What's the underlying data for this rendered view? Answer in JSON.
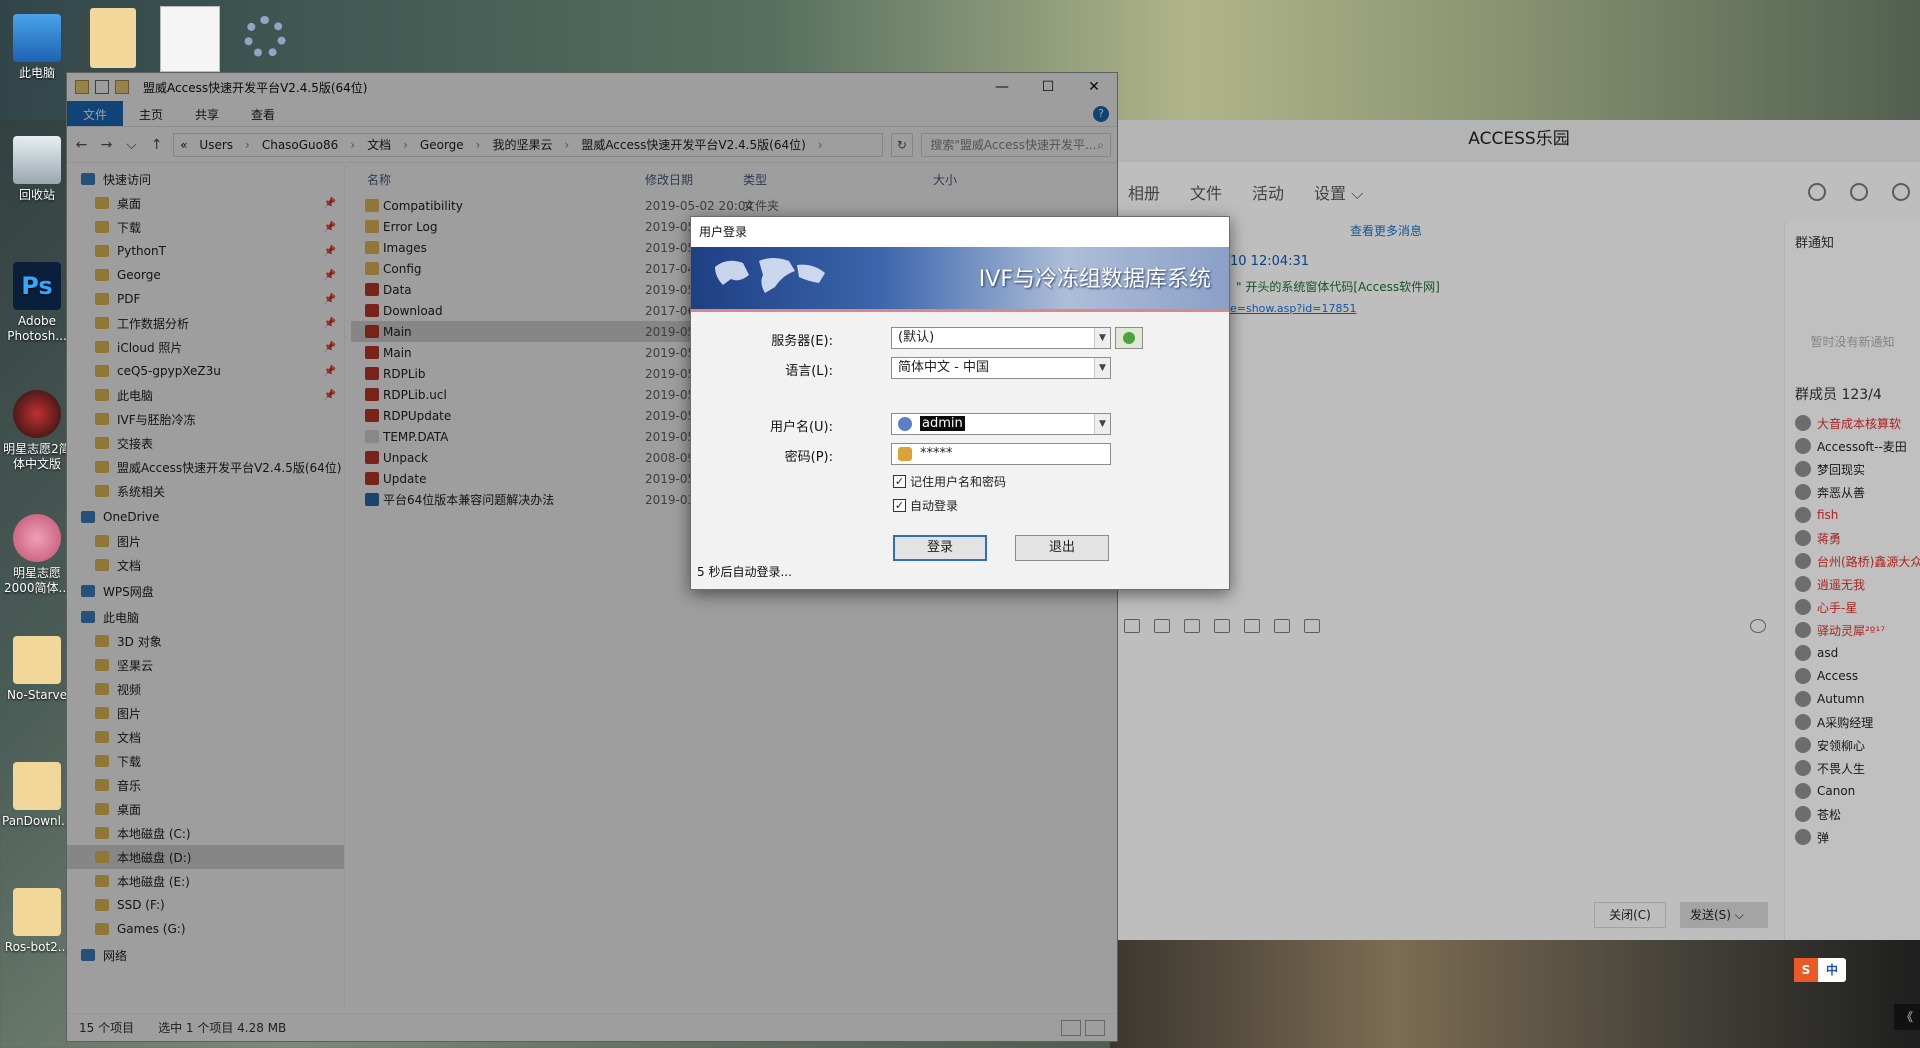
{
  "desktop": {
    "icons": [
      {
        "label": "此电脑"
      },
      {
        "label": "回收站"
      },
      {
        "label": "Adobe Photosh..."
      },
      {
        "label": "明星志愿2简体中文版"
      },
      {
        "label": "明星志愿2000简体..."
      },
      {
        "label": "No-Starve"
      },
      {
        "label": "PanDownl..."
      },
      {
        "label": "Ros-bot2..."
      }
    ]
  },
  "explorer": {
    "title": "盟威Access快速开发平台V2.4.5版(64位)",
    "ribbon_tabs": [
      "文件",
      "主页",
      "共享",
      "查看"
    ],
    "address": [
      "«",
      "Users",
      "ChasoGuo86",
      "文档",
      "George",
      "我的坚果云",
      "盟威Access快速开发平台V2.4.5版(64位)"
    ],
    "search_placeholder": "搜索\"盟威Access快速开发平...",
    "nav": [
      {
        "label": "快速访问",
        "group": true
      },
      {
        "label": "桌面",
        "pinned": true
      },
      {
        "label": "下载",
        "pinned": true
      },
      {
        "label": "PythonT",
        "pinned": true
      },
      {
        "label": "George",
        "pinned": true
      },
      {
        "label": "PDF",
        "pinned": true
      },
      {
        "label": "工作数据分析",
        "pinned": true
      },
      {
        "label": "iCloud 照片",
        "pinned": true
      },
      {
        "label": "ceQ5-gpypXeZ3u",
        "pinned": true
      },
      {
        "label": "此电脑",
        "pinned": true
      },
      {
        "label": "IVF与胚胎冷冻"
      },
      {
        "label": "交接表"
      },
      {
        "label": "盟威Access快速开发平台V2.4.5版(64位)"
      },
      {
        "label": "系统相关"
      },
      {
        "label": "OneDrive",
        "group": true
      },
      {
        "label": "图片"
      },
      {
        "label": "文档"
      },
      {
        "label": "WPS网盘",
        "group": true
      },
      {
        "label": "此电脑",
        "group": true
      },
      {
        "label": "3D 对象"
      },
      {
        "label": "坚果云"
      },
      {
        "label": "视频"
      },
      {
        "label": "图片"
      },
      {
        "label": "文档"
      },
      {
        "label": "下载"
      },
      {
        "label": "音乐"
      },
      {
        "label": "桌面"
      },
      {
        "label": "本地磁盘 (C:)"
      },
      {
        "label": "本地磁盘 (D:)",
        "selected": true
      },
      {
        "label": "本地磁盘 (E:)"
      },
      {
        "label": "SSD (F:)"
      },
      {
        "label": "Games (G:)"
      },
      {
        "label": "网络",
        "group": true
      }
    ],
    "columns": {
      "name": "名称",
      "date": "修改日期",
      "type": "类型",
      "size": "大小"
    },
    "files": [
      {
        "name": "Compatibility",
        "date": "2019-05-02 20:04",
        "type": "文件夹",
        "color": "#e8c15a"
      },
      {
        "name": "Error Log",
        "date": "2019-05-1",
        "type": "",
        "color": "#e8c15a"
      },
      {
        "name": "Images",
        "date": "2019-05-0",
        "type": "",
        "color": "#e8c15a"
      },
      {
        "name": "Config",
        "date": "2017-04-2",
        "type": "",
        "color": "#e8c15a"
      },
      {
        "name": "Data",
        "date": "2019-05-1",
        "type": "",
        "color": "#c0392b"
      },
      {
        "name": "Download",
        "date": "2017-06-1",
        "type": "",
        "color": "#c0392b"
      },
      {
        "name": "Main",
        "date": "2019-05-1",
        "type": "",
        "color": "#c0392b",
        "selected": true
      },
      {
        "name": "Main",
        "date": "2019-05-1",
        "type": "",
        "color": "#c0392b"
      },
      {
        "name": "RDPLib",
        "date": "2019-05-1",
        "type": "",
        "color": "#c0392b"
      },
      {
        "name": "RDPLib.ucl",
        "date": "2019-05-1",
        "type": "",
        "color": "#c0392b"
      },
      {
        "name": "RDPUpdate",
        "date": "2019-05-1",
        "type": "",
        "color": "#c0392b"
      },
      {
        "name": "TEMP.DATA",
        "date": "2019-05-1",
        "type": "",
        "color": "#dcdcdc"
      },
      {
        "name": "Unpack",
        "date": "2008-09-3",
        "type": "",
        "color": "#c0392b"
      },
      {
        "name": "Update",
        "date": "2019-05-1",
        "type": "",
        "color": "#c0392b"
      },
      {
        "name": "平台64位版本兼容问题解决办法",
        "date": "2019-03-2",
        "type": "",
        "color": "#2b6cb0"
      }
    ],
    "status": {
      "count": "15 个项目",
      "selection": "选中 1 个项目  4.28 MB"
    }
  },
  "chat": {
    "title": "ACCESS乐园",
    "tabs": [
      "相册",
      "文件",
      "活动",
      "设置 ⌵"
    ],
    "more_messages": "查看更多消息",
    "time": "10 12:04:31",
    "line2": "\" 开头的系统窗体代码[Access软件网]",
    "line3": "e=show.asp?id=17851",
    "notice_title": "群通知",
    "notice_empty": "暂时没有新通知",
    "members_title": "群成员 123/4",
    "members": [
      {
        "name": "大音成本核算软",
        "color": "#d9302c"
      },
      {
        "name": "Accessoft--麦田",
        "color": "#222"
      },
      {
        "name": "梦回现实",
        "color": "#222"
      },
      {
        "name": "奔恶从善",
        "color": "#222"
      },
      {
        "name": "fish",
        "color": "#d9302c"
      },
      {
        "name": "蒋勇",
        "color": "#d9302c"
      },
      {
        "name": "台州(路桥)鑫源大众",
        "color": "#d9302c"
      },
      {
        "name": "逍遥无我",
        "color": "#d9302c"
      },
      {
        "name": "心手-星",
        "color": "#d9302c"
      },
      {
        "name": "驿动灵犀²º¹⁷",
        "color": "#d9302c"
      },
      {
        "name": "asd",
        "color": "#222"
      },
      {
        "name": "Access",
        "color": "#222"
      },
      {
        "name": "Autumn",
        "color": "#222"
      },
      {
        "name": "A采购经理",
        "color": "#222"
      },
      {
        "name": "安领柳心",
        "color": "#222"
      },
      {
        "name": "不畏人生",
        "color": "#222"
      },
      {
        "name": "Canon",
        "color": "#222"
      },
      {
        "name": "苍松",
        "color": "#222"
      },
      {
        "name": "弹",
        "color": "#222"
      }
    ],
    "close_label": "关闭(C)",
    "send_label": "发送(S)  ⌵"
  },
  "dialog": {
    "title": "用户登录",
    "banner_title": "IVF与冷冻组数据库系统",
    "server_label": "服务器(E):",
    "server_value": "(默认)",
    "language_label": "语言(L):",
    "language_value": "简体中文 - 中国",
    "username_label": "用户名(U):",
    "username_value": "admin",
    "password_label": "密码(P):",
    "password_value": "*****",
    "remember_label": "记住用户名和密码",
    "autologin_label": "自动登录",
    "login_button": "登录",
    "exit_button": "退出",
    "countdown": "5 秒后自动登录..."
  },
  "ime": {
    "logo": "S",
    "mode": "中"
  },
  "tray": {
    "expand": "《"
  }
}
